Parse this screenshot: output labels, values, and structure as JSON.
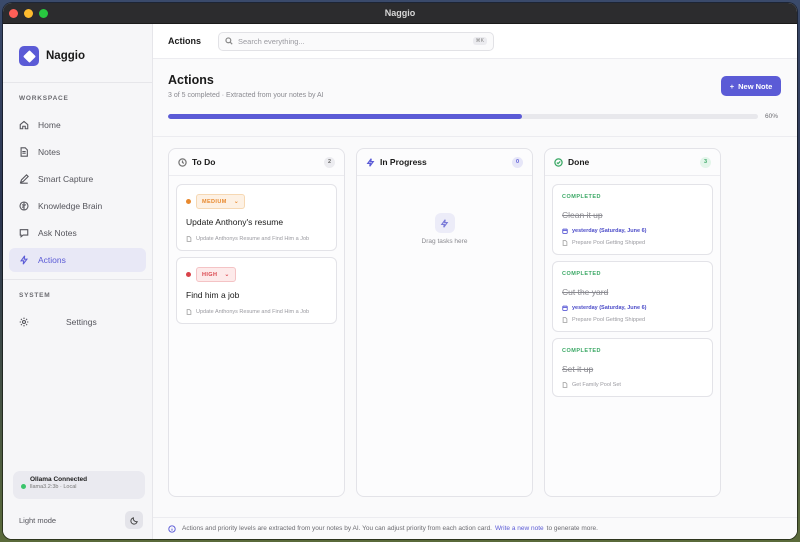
{
  "window": {
    "title": "Naggio"
  },
  "sidebar": {
    "brand": "Naggio",
    "workspace_label": "WORKSPACE",
    "items": [
      {
        "label": "Home",
        "icon": "home-icon"
      },
      {
        "label": "Notes",
        "icon": "document-icon"
      },
      {
        "label": "Smart Capture",
        "icon": "pencil-icon"
      },
      {
        "label": "Knowledge Brain",
        "icon": "brain-icon"
      },
      {
        "label": "Ask Notes",
        "icon": "chat-icon"
      },
      {
        "label": "Actions",
        "icon": "bolt-icon",
        "active": true
      }
    ],
    "system_label": "SYSTEM",
    "settings_label": "Settings",
    "status": {
      "title": "Ollama Connected",
      "subtitle": "llama3.2:3b · Local"
    },
    "theme_label": "Light mode"
  },
  "topbar": {
    "title": "Actions",
    "search_placeholder": "Search everything...",
    "shortcut": "⌘K"
  },
  "page": {
    "title": "Actions",
    "subtitle": "3 of 5 completed · Extracted from your notes by AI",
    "new_note_label": "New Note",
    "progress": 0.6,
    "progress_label": "60%"
  },
  "columns": {
    "todo": {
      "name": "To Do",
      "count": "2",
      "cards": [
        {
          "priority": "MEDIUM",
          "title": "Update Anthony's resume",
          "source": "Update Anthonys Resume and Find Him a Job"
        },
        {
          "priority": "HIGH",
          "title": "Find him a job",
          "source": "Update Anthonys Resume and Find Him a Job"
        }
      ]
    },
    "in_progress": {
      "name": "In Progress",
      "count": "0",
      "empty_text": "Drag tasks here"
    },
    "done": {
      "name": "Done",
      "count": "3",
      "cards": [
        {
          "badge": "COMPLETED",
          "title": "Clean it up",
          "date": "yesterday (Saturday, June 6)",
          "source": "Prepare Pool Getting Shipped"
        },
        {
          "badge": "COMPLETED",
          "title": "Cut the yard",
          "date": "yesterday (Saturday, June 6)",
          "source": "Prepare Pool Getting Shipped"
        },
        {
          "badge": "COMPLETED",
          "title": "Set it up",
          "source": "Get Family Pool Set"
        }
      ]
    }
  },
  "footer": {
    "text": "Actions and priority levels are extracted from your notes by AI. You can adjust priority from each action card.",
    "link": "Write a new note",
    "suffix": "to generate more."
  },
  "colors": {
    "accent": "#5b5bd6",
    "medium": "#e8892e",
    "high": "#d9434a",
    "done": "#3aa865"
  }
}
